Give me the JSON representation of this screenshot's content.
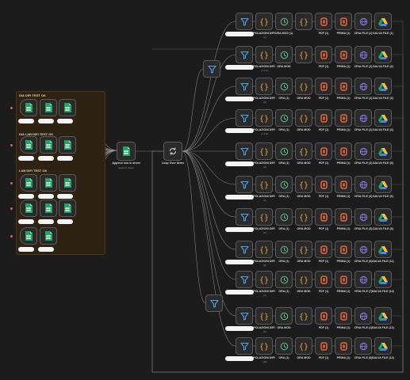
{
  "groups": [
    {
      "label": "DIA DIFI TEST OK"
    },
    {
      "label": "DIA LAB DIFI TEST OK"
    },
    {
      "label": "LAB DIFI TEST OK"
    }
  ],
  "center": {
    "append_label": "Append row in sheet",
    "append_sub": "append: sheet",
    "loop_label": "Loop Over Items"
  },
  "rows": [
    {
      "labels": [
        "",
        "POLAZIONI DIFI",
        "ORA MOD (1)",
        "",
        "PDF (1)",
        "PRIMA (1)",
        "CRIA FILE (1)",
        "SALVA FILE (1)"
      ],
      "sub": "(1)"
    },
    {
      "labels": [
        "",
        "POLAZIONI DIFI",
        "ORA MOD",
        "",
        "PDF (1)",
        "PRIMA (1)",
        "CRIA FILE (1)",
        "SALVA FILE (2)"
      ],
      "sub": "p 2 (1)"
    },
    {
      "labels": [
        "",
        "POLAZIONI DIFI",
        "ORA (1)",
        "ORA MOD",
        "PDF (1)",
        "PRIMA (1)",
        "CRIA FILE (1)",
        "SALVA FILE (3)"
      ],
      "sub": "(2)"
    },
    {
      "labels": [
        "",
        "POLAZIONI DIFI",
        "ORA (1)",
        "ORA MOD",
        "PDF (1)",
        "PRIMA (1)",
        "CRIA FILE (2)",
        "SALVA FILE (4)"
      ],
      "sub": "p 4 (2)"
    },
    {
      "labels": [
        "",
        "POLAZIONI DIFI",
        "ORA (1)",
        "ORA MOD",
        "PDF (1)",
        "PRIMA (1)",
        "CRIA FILE (3)",
        "SALVA FILE (5)"
      ],
      "sub": "(4)"
    },
    {
      "labels": [
        "",
        "POLAZIONI DIFI",
        "ORA (1)",
        "ORA MOD",
        "PDF (1)",
        "PRIMA (1)",
        "CRIA FILE (4)",
        "SALVA FILE (6)"
      ],
      "sub": "(5)"
    },
    {
      "labels": [
        "",
        "POLAZIONI DIFI",
        "ORA (1)",
        "ORA MOD",
        "PDF (1)",
        "PRIMA (1)",
        "CRIA FILE (5)",
        "SALVA FILE (8)"
      ],
      "sub": "(6)"
    },
    {
      "labels": [
        "",
        "POLAZIONI DIFI",
        "ORA (1)",
        "ORA MOD",
        "PDF (1)",
        "PRIMA (1)",
        "CRIA FILE (6)",
        "SALVA FILE (11)"
      ],
      "sub": "(6)"
    },
    {
      "labels": [
        "",
        "POLAZIONI DIFI",
        "ORA (1)",
        "ORA MOD",
        "PDF (1)",
        "PRIMA (1)",
        "CRIA FILE (7)",
        "SALVA FILE (12)"
      ],
      "sub": "(7)"
    },
    {
      "labels": [
        "",
        "POLAZIONI DIFI",
        "ORA MOD",
        "",
        "PDF (1)",
        "PRIMA (1)",
        "CRIA FILE (1)",
        "SALVA FILE (13)"
      ],
      "sub": "(9)"
    },
    {
      "labels": [
        "",
        "POLAZIONI DIFI",
        "ORA (1)",
        "ORA MOD",
        "PDF (1)",
        "PRIMA (1)",
        "CRIA FILE (8)",
        "SALVA FILE (12)"
      ],
      "sub": "(10)"
    }
  ],
  "colors": {
    "canvas": "#1c1c1c",
    "group_bg": "#2e2212",
    "sheets_green": "#1fa463",
    "filter_blue": "#4aa3e8",
    "code_orange": "#e8a33d",
    "clock_green": "#5bc08a",
    "pdf_orange": "#e8663d",
    "globe_purple": "#8a7be8",
    "wire": "#9a9a9a"
  },
  "icons": {
    "sheets": "google-sheets-icon",
    "filter": "filter-icon",
    "code": "code-braces-icon",
    "clock": "clock-icon",
    "pdf": "document-icon",
    "globe": "globe-icon",
    "drive": "google-drive-icon",
    "loop": "loop-icon"
  }
}
